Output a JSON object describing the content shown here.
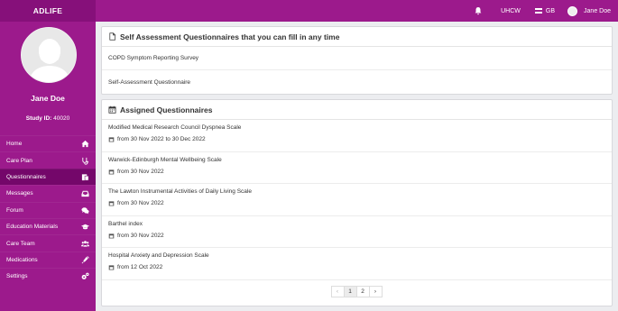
{
  "brand": "ADLIFE",
  "topbar": {
    "org": "UHCW",
    "lang": "GB",
    "user": "Jane Doe"
  },
  "profile": {
    "name": "Jane Doe",
    "study_label": "Study ID:",
    "study_id": "40020"
  },
  "menu": [
    {
      "label": "Home",
      "icon": "home-icon"
    },
    {
      "label": "Care Plan",
      "icon": "stethoscope-icon"
    },
    {
      "label": "Questionnaires",
      "icon": "clipboard-icon"
    },
    {
      "label": "Messages",
      "icon": "inbox-icon"
    },
    {
      "label": "Forum",
      "icon": "comments-icon"
    },
    {
      "label": "Education Materials",
      "icon": "graduation-cap-icon"
    },
    {
      "label": "Care Team",
      "icon": "users-icon"
    },
    {
      "label": "Medications",
      "icon": "syringe-icon"
    },
    {
      "label": "Settings",
      "icon": "gears-icon"
    }
  ],
  "self_assessment": {
    "title": "Self Assessment Questionnaires that you can fill in any time",
    "items": [
      "COPD Symptom Reporting Survey",
      "Self-Assessment Questionnaire"
    ]
  },
  "assigned": {
    "title": "Assigned Questionnaires",
    "items": [
      {
        "title": "Modified Medical Research Council Dyspnea Scale",
        "date": "from 30 Nov 2022 to 30 Dec 2022"
      },
      {
        "title": "Warwick-Edinburgh Mental Wellbeing Scale",
        "date": "from 30 Nov 2022"
      },
      {
        "title": "The Lawton Instrumental Activities of Daily Living Scale",
        "date": "from 30 Nov 2022"
      },
      {
        "title": "Barthel index",
        "date": "from 30 Nov 2022"
      },
      {
        "title": "Hospital Anxiety and Depression Scale",
        "date": "from 12 Oct 2022"
      }
    ]
  },
  "pagination": {
    "prev": "‹",
    "pages": [
      "1",
      "2"
    ],
    "next": "›",
    "current": "1"
  }
}
